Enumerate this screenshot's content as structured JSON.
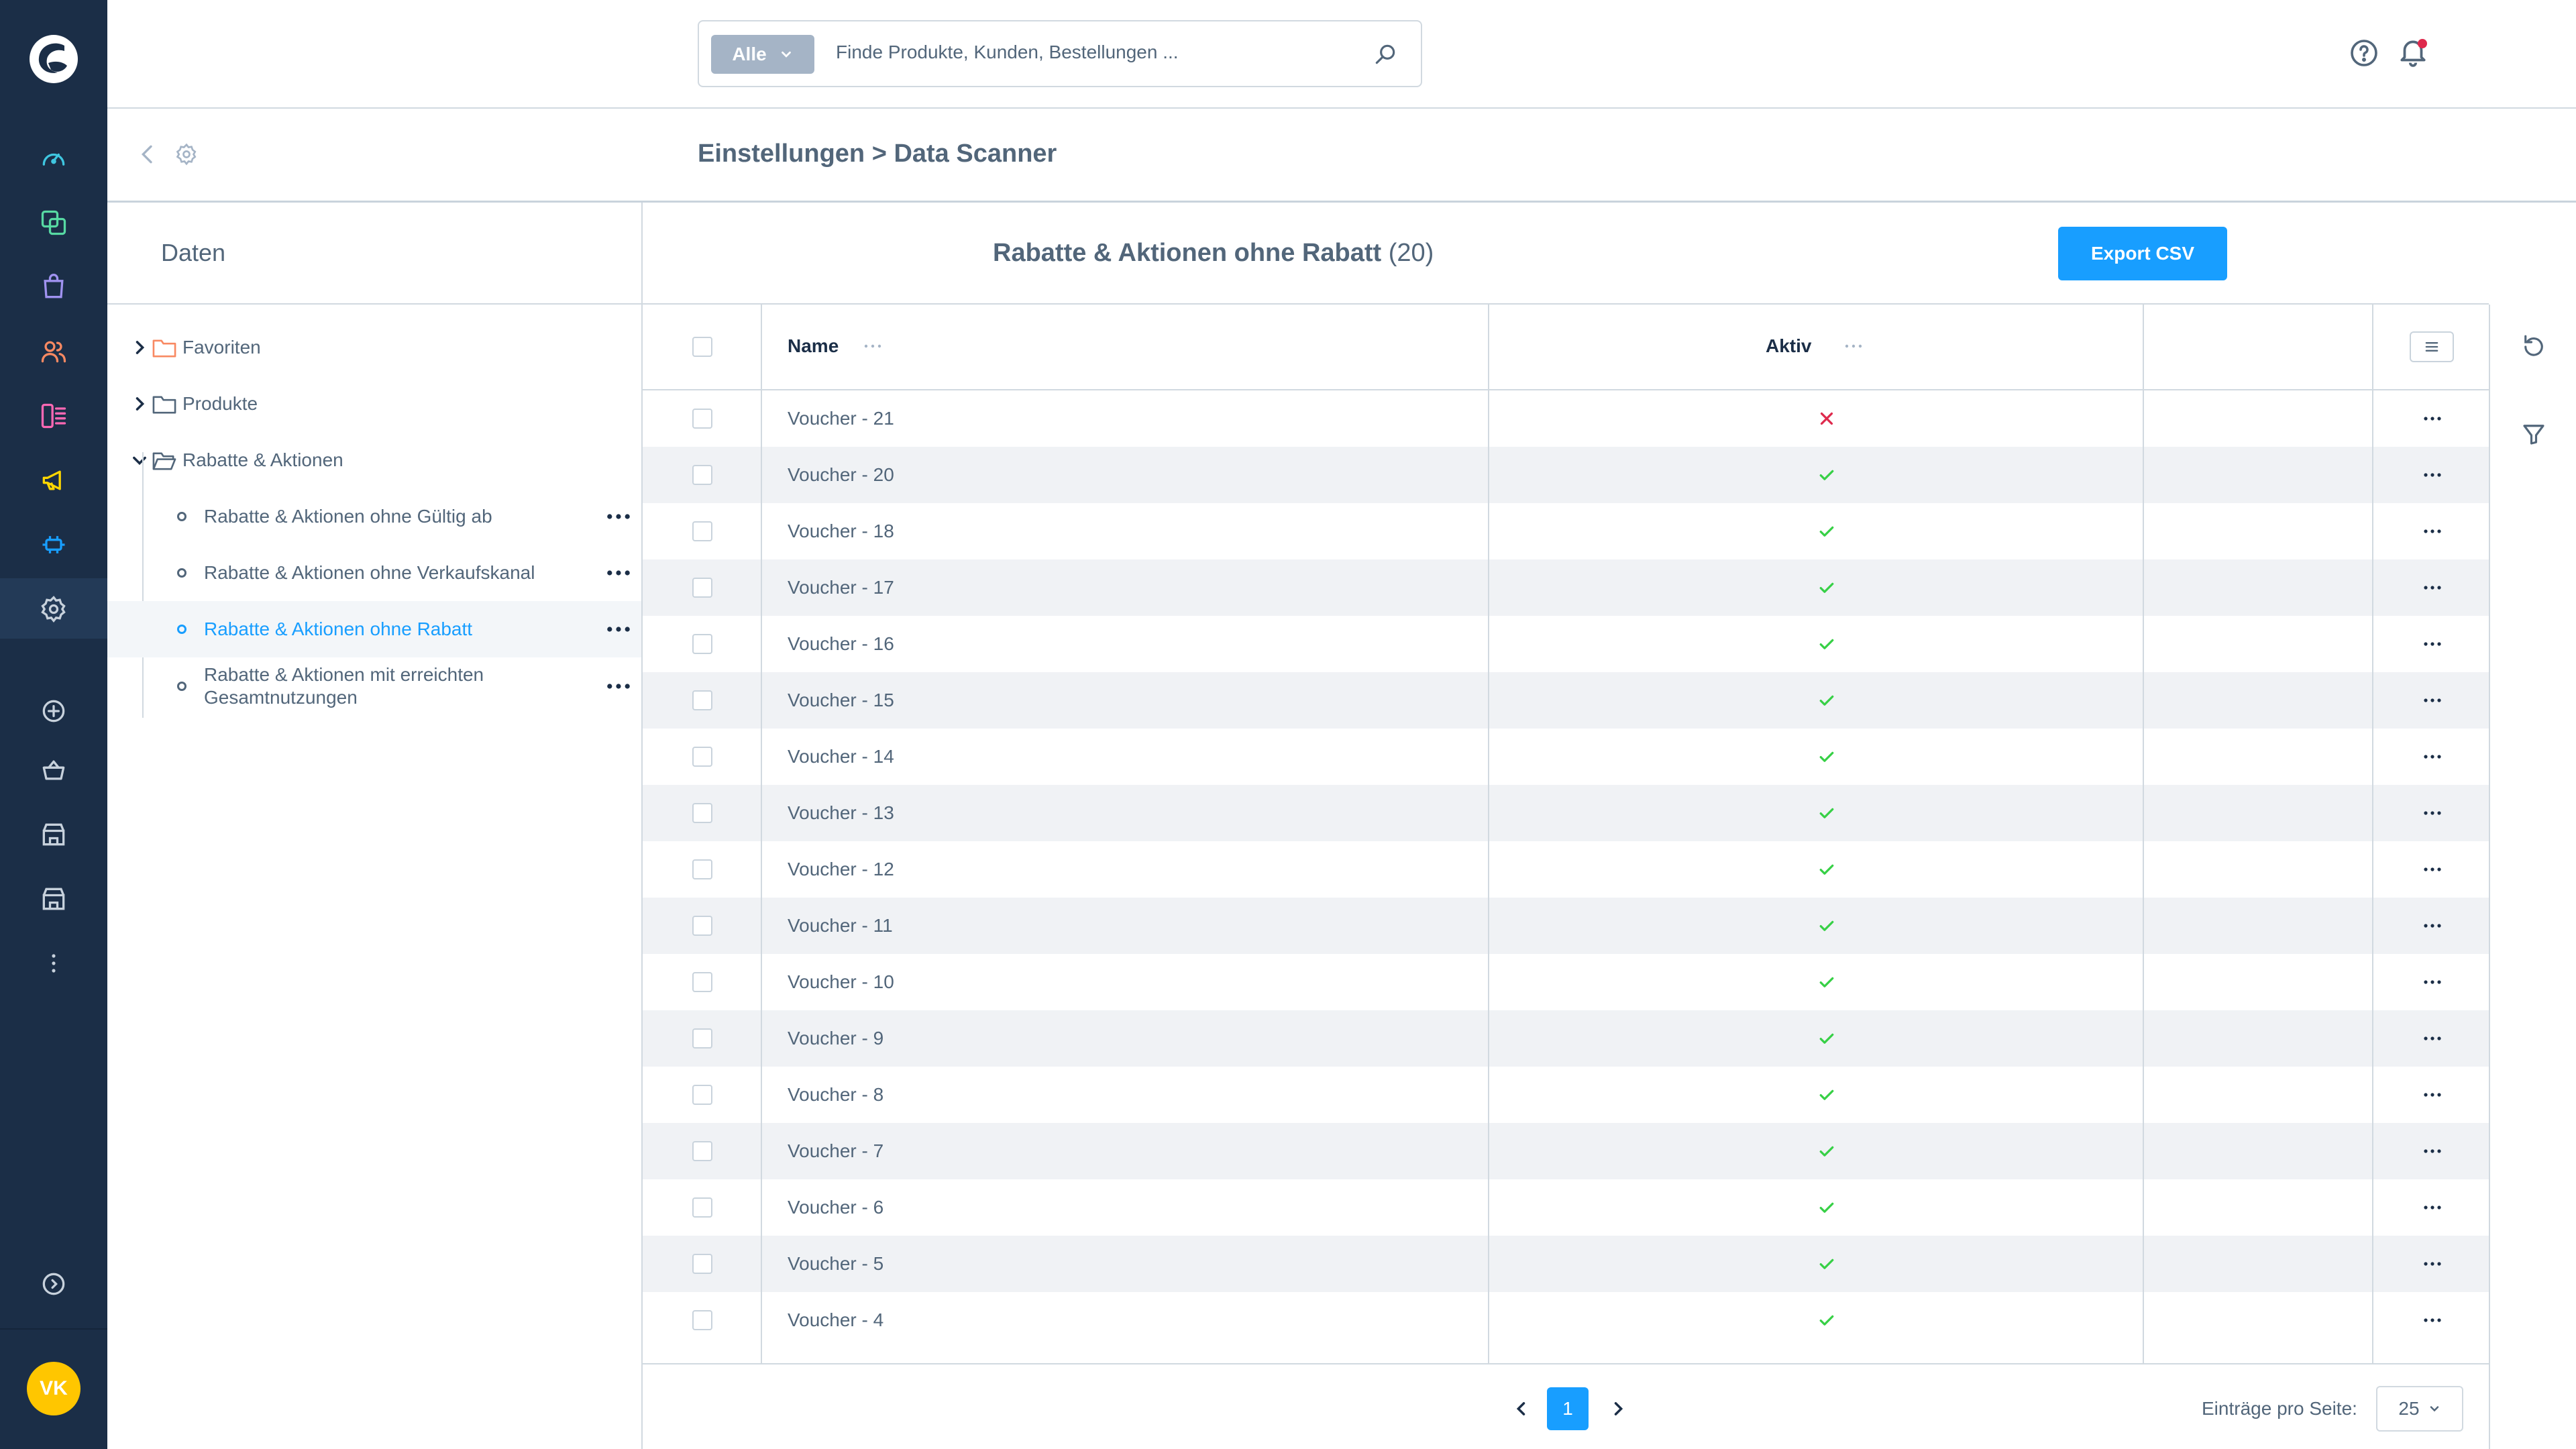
{
  "sidebar": {
    "avatar_initials": "VK",
    "icons": [
      "dashboard-icon",
      "catalogue-icon",
      "orders-icon",
      "customers-icon",
      "content-icon",
      "marketing-icon",
      "extensions-icon",
      "settings-icon",
      "add-channel-icon",
      "sales-channel-basket-icon",
      "sales-channel-store-icon",
      "sales-channel-store-2-icon",
      "more-icon",
      "collapse-icon"
    ]
  },
  "search": {
    "type_label": "Alle",
    "placeholder": "Finde Produkte, Kunden, Bestellungen ..."
  },
  "breadcrumb": "Einstellungen > Data Scanner",
  "tree": {
    "header": "Daten",
    "folders": [
      {
        "label": "Favoriten"
      },
      {
        "label": "Produkte"
      },
      {
        "label": "Rabatte & Aktionen"
      }
    ],
    "children": [
      {
        "label": "Rabatte & Aktionen ohne Gültig ab"
      },
      {
        "label": "Rabatte & Aktionen ohne Verkaufskanal"
      },
      {
        "label": "Rabatte & Aktionen ohne Rabatt"
      },
      {
        "label": "Rabatte & Aktionen mit erreichten Gesamtnutzungen"
      }
    ]
  },
  "content": {
    "title": "Rabatte & Aktionen ohne Rabatt",
    "count": "(20)",
    "export_label": "Export CSV"
  },
  "grid": {
    "columns": [
      "Name",
      "Aktiv"
    ],
    "rows": [
      {
        "name": "Voucher - 21",
        "active": false
      },
      {
        "name": "Voucher - 20",
        "active": true
      },
      {
        "name": "Voucher - 18",
        "active": true
      },
      {
        "name": "Voucher - 17",
        "active": true
      },
      {
        "name": "Voucher - 16",
        "active": true
      },
      {
        "name": "Voucher - 15",
        "active": true
      },
      {
        "name": "Voucher - 14",
        "active": true
      },
      {
        "name": "Voucher - 13",
        "active": true
      },
      {
        "name": "Voucher - 12",
        "active": true
      },
      {
        "name": "Voucher - 11",
        "active": true
      },
      {
        "name": "Voucher - 10",
        "active": true
      },
      {
        "name": "Voucher - 9",
        "active": true
      },
      {
        "name": "Voucher - 8",
        "active": true
      },
      {
        "name": "Voucher - 7",
        "active": true
      },
      {
        "name": "Voucher - 6",
        "active": true
      },
      {
        "name": "Voucher - 5",
        "active": true
      },
      {
        "name": "Voucher - 4",
        "active": true
      }
    ]
  },
  "pagination": {
    "current_page": "1",
    "per_page_label": "Einträge pro Seite:",
    "per_page_value": "25"
  },
  "colors": {
    "sidebar_bg": "#1b2e47",
    "accent": "#189eff",
    "success": "#37d046",
    "danger": "#de294c",
    "avatar": "#ffc600"
  }
}
